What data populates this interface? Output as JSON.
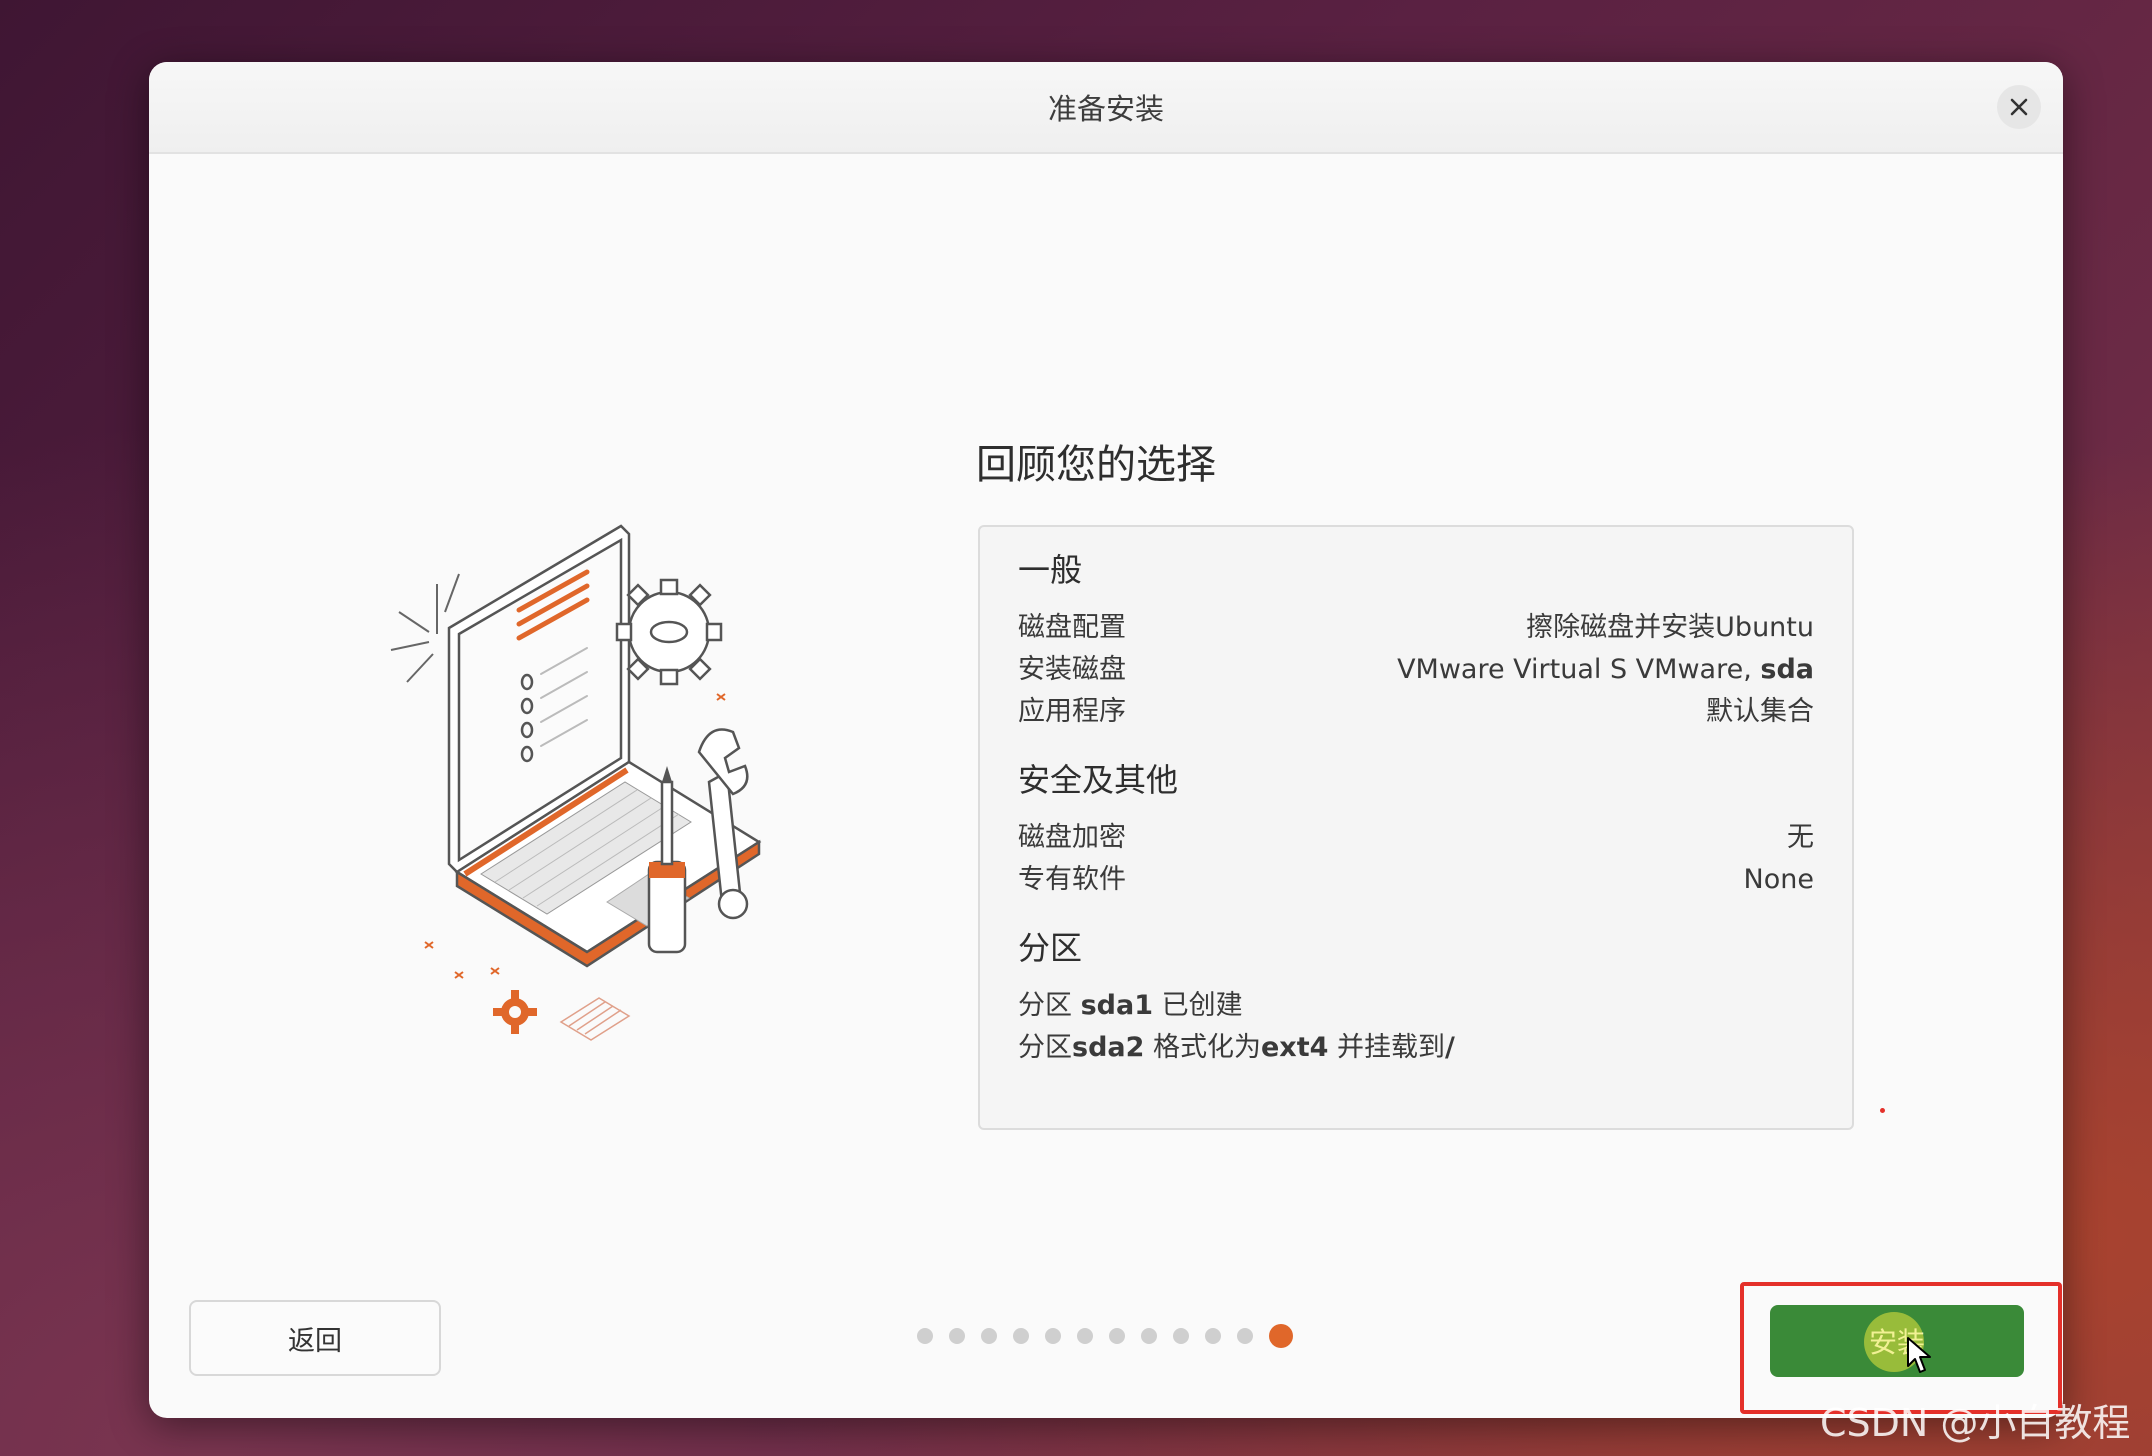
{
  "window": {
    "title": "准备安装",
    "close_icon": "close-icon"
  },
  "main": {
    "heading": "回顾您的选择",
    "sections": {
      "general": {
        "title": "一般",
        "rows": [
          {
            "label": "磁盘配置",
            "value": "擦除磁盘并安装Ubuntu"
          },
          {
            "label": "安装磁盘",
            "value_prefix": "VMware Virtual S VMware, ",
            "value_bold": "sda"
          },
          {
            "label": "应用程序",
            "value": "默认集合"
          }
        ]
      },
      "security": {
        "title": "安全及其他",
        "rows": [
          {
            "label": "磁盘加密",
            "value": "无"
          },
          {
            "label": "专有软件",
            "value": "None"
          }
        ]
      },
      "partitions": {
        "title": "分区",
        "line1": {
          "prefix": "分区 ",
          "bold": "sda1",
          "suffix": " 已创建"
        },
        "line2": {
          "prefix": "分区",
          "bold1": "sda2",
          "middle": " 格式化为",
          "bold2": "ext4",
          "suffix": " 并挂载到",
          "bold3": "/"
        }
      }
    }
  },
  "footer": {
    "back_label": "返回",
    "install_label": "安装",
    "progress": {
      "total_steps": 12,
      "current_step": 12
    }
  },
  "colors": {
    "accent": "#e0672a",
    "install_green": "#3a8a38",
    "highlight_red": "#e4302a"
  },
  "watermark": "CSDN @小白教程"
}
